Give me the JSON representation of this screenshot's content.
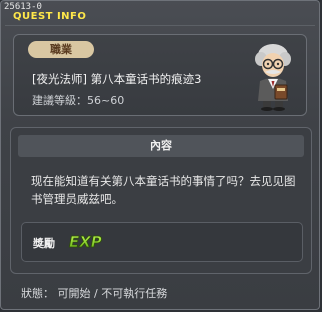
{
  "window": {
    "id": "25613-0",
    "title": "QUEST INFO"
  },
  "quest": {
    "job_badge": "職業",
    "name": "[夜光法师] 第八本童话书的痕迹3",
    "level": "建議等級：56~60"
  },
  "content": {
    "header": "內容",
    "text": "现在能知道有关第八本童话书的事情了吗？去见见图书管理员威兹吧。"
  },
  "reward": {
    "label": "獎勵",
    "exp": "EXP",
    "icon": "exp-icon",
    "exp_color": "#8bdc1e"
  },
  "status": {
    "text": "狀態： 可開始 / 不可執行任務"
  },
  "colors": {
    "title": "#ffe84a",
    "badge_bg": "#d9c7a2"
  },
  "icons": {
    "npc": "librarian-npc-icon"
  }
}
